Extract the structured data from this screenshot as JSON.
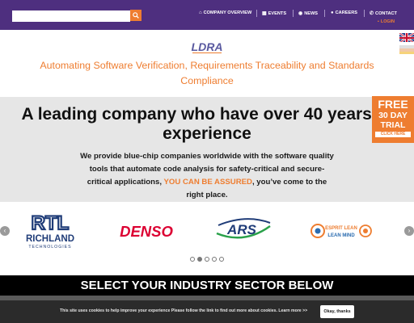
{
  "search": {
    "value": "",
    "placeholder": ""
  },
  "nav": {
    "company": "COMPANY OVERVIEW",
    "events": "EVENTS",
    "news": "NEWS",
    "careers": "CAREERS",
    "contact": "CONTACT",
    "login": "LOGIN"
  },
  "brand": {
    "logo_text": "LDRA"
  },
  "tagline": "Automating Software Verification, Requirements Traceability and Standards Compliance",
  "hero": {
    "title": "A leading company who have over 40 years of experience",
    "text_before": "We provide blue-chip companies worldwide with the software quality tools that automate code analysis for safety-critical and secure-critical applications, ",
    "highlight": "YOU CAN BE ASSURED",
    "text_after": ", you’ve come to the right place."
  },
  "trial": {
    "line1": "FREE",
    "line2": "30 DAY",
    "line3": "TRIAL",
    "cta": "CLICK HERE"
  },
  "clients": {
    "richland_mark": "RTL",
    "richland_name": "RICHLAND",
    "richland_sub": "TECHNOLOGIES",
    "denso": "DENSO",
    "ars": "ARS",
    "esprit_line1": "ESPRIT LEAN",
    "esprit_line2": "LEAN MIND"
  },
  "carousel": {
    "slides": 5,
    "active_index": 1
  },
  "sector_heading": "SELECT YOUR INDUSTRY SECTOR BELOW",
  "cookie": {
    "message": "This site uses cookies to help improve your experience Please follow the link to find out more about cookies.",
    "learn_more": "Learn more >>",
    "accept": "Okay, thanks"
  },
  "colors": {
    "nav_bg": "#4e2f7f",
    "accent": "#ee7d30",
    "hero_bg": "#e6e6e6",
    "denso_red": "#dc0032",
    "richland_blue": "#1f3c78"
  }
}
